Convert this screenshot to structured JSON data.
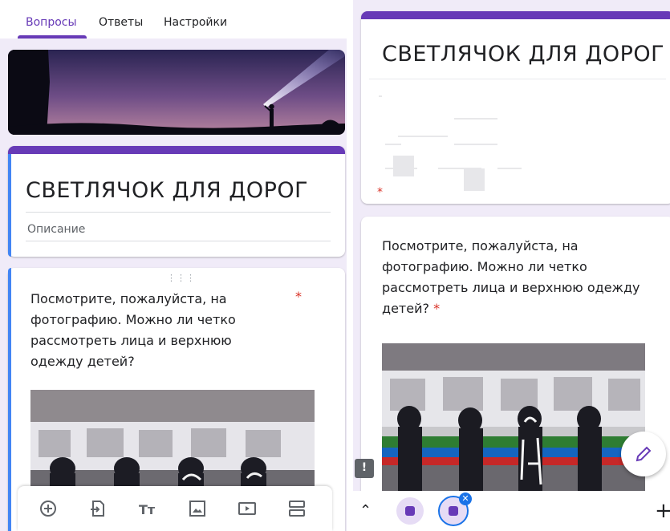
{
  "left_screen": {
    "tabs": [
      {
        "label": "Вопросы",
        "active": true
      },
      {
        "label": "Ответы",
        "active": false
      },
      {
        "label": "Настройки",
        "active": false
      }
    ],
    "form": {
      "title": "СВЕТЛЯЧОК ДЛЯ ДОРОГ",
      "description_placeholder": "Описание"
    },
    "question": {
      "text": "Посмотрите, пожалуйста, на фотографию. Можно ли четко рассмотреть лица и верхнюю одежду детей?",
      "required_mark": "*"
    },
    "toolbar": {
      "items": [
        "add-question-icon",
        "import-questions-icon",
        "add-title-icon",
        "add-image-icon",
        "add-video-icon",
        "add-section-icon"
      ]
    }
  },
  "right_screen": {
    "form": {
      "title": "СВЕТЛЯЧОК ДЛЯ ДОРОГ"
    },
    "question": {
      "text": "Посмотрите, пожалуйста, на фотографию. Можно ли четко рассмотреть лица и верхнюю одежду детей?",
      "required_mark": "*"
    },
    "bottom_bar": {
      "icons": [
        "chevron-up-icon",
        "app-bubble-icon",
        "active-bubble-icon",
        "plus-icon"
      ]
    },
    "fab_icon": "pencil-icon",
    "feedback_icon": "feedback-icon"
  },
  "colors": {
    "accent": "#673ab7",
    "background": "#f0ebf8",
    "active_tab": "#673ab7",
    "required": "#d93025",
    "left_border": "#4285f4"
  }
}
